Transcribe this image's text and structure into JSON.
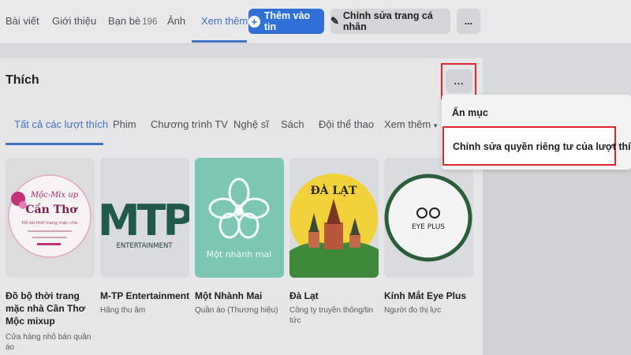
{
  "profile_nav": {
    "tabs": [
      {
        "label": "Bài viết"
      },
      {
        "label": "Giới thiệu"
      },
      {
        "label": "Bạn bè",
        "count": "196"
      },
      {
        "label": "Ảnh"
      },
      {
        "label": "Xem thêm"
      }
    ],
    "add_story_label": "Thêm vào tin",
    "edit_profile_label": "Chỉnh sửa trang cá nhân",
    "more_label": "..."
  },
  "likes": {
    "title": "Thích",
    "more_label": "...",
    "filter_tabs": [
      "Tất cả các lượt thích",
      "Phim",
      "Chương trình TV",
      "Nghệ sĩ",
      "Sách",
      "Đội thể thao",
      "Xem thêm"
    ],
    "pages": [
      {
        "name": "Đồ bộ thời trang mặc nhà Cần Thơ Mộc mixup",
        "category": "Cửa hàng nhỏ bán quần áo",
        "logo_text": "Mộc-Mix up",
        "logo_subtext": "Cần Thơ",
        "logo_tag": "Đồ bộ thời trang mặc nhà"
      },
      {
        "name": "M-TP Entertainment",
        "category": "Hãng thu âm",
        "logo_text": "MTP",
        "logo_subtext": "ENTERTAINMENT"
      },
      {
        "name": "Một Nhành Mai",
        "category": "Quần áo (Thương hiệu)",
        "logo_text": "Một nhành mai"
      },
      {
        "name": "Đà Lạt",
        "category": "Công ty truyền thông/tin tức",
        "logo_text": "ĐÀ LẠT"
      },
      {
        "name": "Kính Mắt Eye Plus",
        "category": "Người đo thị lực",
        "logo_text": "EYE PLUS"
      }
    ]
  },
  "dropdown": {
    "hide_label": "Ẩn mục",
    "privacy_label": "Chỉnh sửa quyền riêng tư của lượt thích"
  },
  "colors": {
    "accent": "#3f72c4",
    "primary_button": "#2f6fd6",
    "highlight": "#e0252b"
  }
}
